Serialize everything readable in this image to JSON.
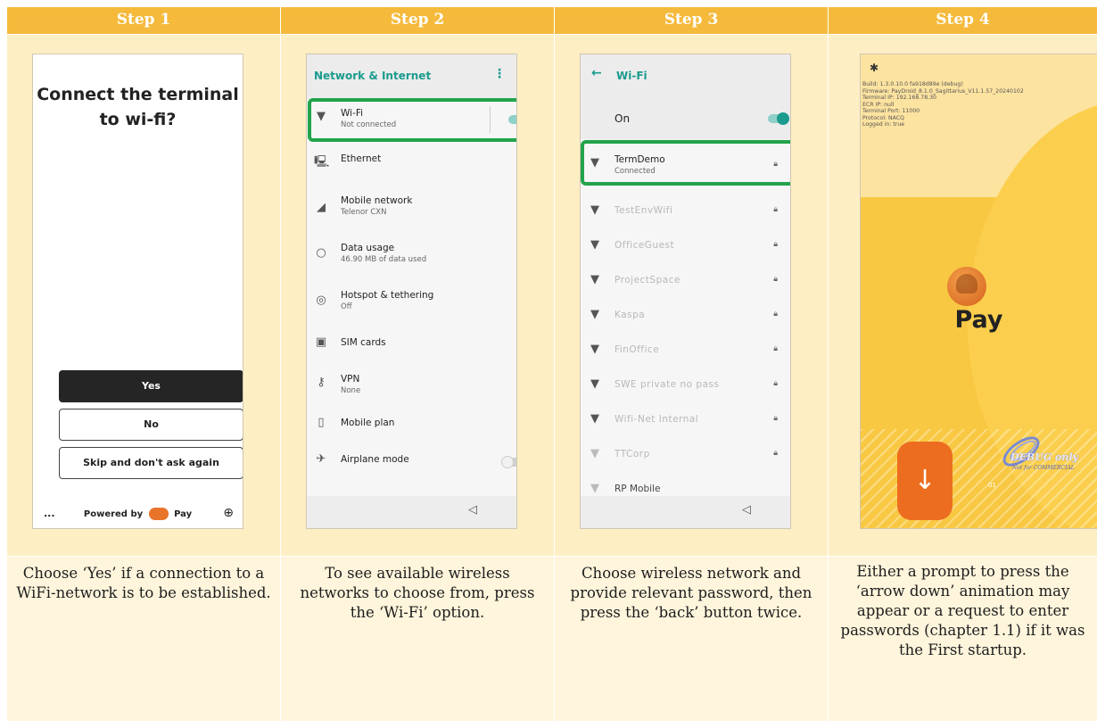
{
  "steps": [
    {
      "header": "Step 1",
      "caption": "Choose ‘Yes’ if a connection to a WiFi-network is to be established."
    },
    {
      "header": "Step 2",
      "caption": "To see available wireless networks to choose from, press the ‘Wi-Fi’ option."
    },
    {
      "header": "Step 3",
      "caption": "Choose wireless network and provide relevant password, then press the ‘back’ button twice."
    },
    {
      "header": "Step 4",
      "caption": "Either a prompt to press the ‘arrow down’ animation may appear or a request to enter passwords (chapter 1.1) if it was the First startup."
    }
  ],
  "phone1": {
    "title": "Connect the terminal to wi-fi?",
    "yes": "Yes",
    "no": "No",
    "skip": "Skip and don't ask again",
    "more": "...",
    "powered_by": "Powered by",
    "brand": "Pay"
  },
  "phone2": {
    "title": "Network & Internet",
    "items": [
      {
        "label": "Wi-Fi",
        "sub": "Not connected"
      },
      {
        "label": "Ethernet",
        "sub": ""
      },
      {
        "label": "Mobile network",
        "sub": "Telenor CXN"
      },
      {
        "label": "Data usage",
        "sub": "46.90 MB of data used"
      },
      {
        "label": "Hotspot & tethering",
        "sub": "Off"
      },
      {
        "label": "SIM cards",
        "sub": ""
      },
      {
        "label": "VPN",
        "sub": "None"
      },
      {
        "label": "Mobile plan",
        "sub": ""
      },
      {
        "label": "Airplane mode",
        "sub": ""
      }
    ],
    "wifi_on": true,
    "airplane_on": false,
    "accent": "#1a9b8d",
    "highlight": "#23a34b"
  },
  "phone3": {
    "title": "Wi-Fi",
    "on_label": "On",
    "connected": {
      "label": "TermDemo",
      "sub": "Connected"
    },
    "networks": [
      "TestEnvWifi",
      "OfficeGuest",
      "ProjectSpace",
      "Kaspa",
      "FinOffice",
      "SWE private no pass",
      "Wifi-Net Internal",
      "TTCorp",
      "RP Mobile"
    ]
  },
  "phone4": {
    "info": [
      "Build: 1.3.0.10.0 fa918d89e (debug)",
      "Firmware: PayDroid_8.1.0_Sagittarius_V11.1.57_20240102",
      "Terminal IP: 192.168.78.30",
      "ECR IP: null",
      "Terminal Port: 11000",
      "Protocol: NACQ",
      "Logged in: true"
    ],
    "brand": "Pay",
    "counter": "01",
    "debug_mark": "DEBUG only",
    "debug_sub": "Not for COMMERCIAL"
  }
}
